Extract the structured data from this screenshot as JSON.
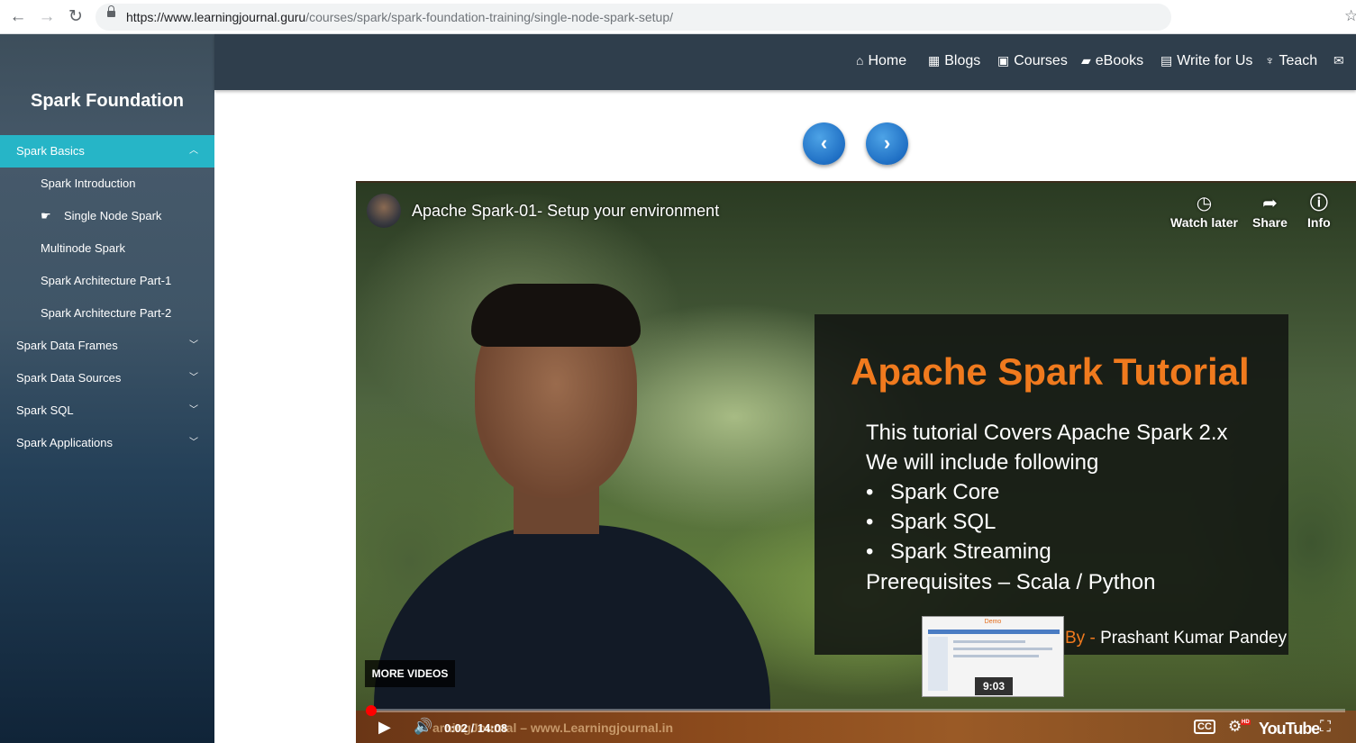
{
  "browser": {
    "url_host": "https://www.learningjournal.guru",
    "url_path": "/courses/spark/spark-foundation-training/single-node-spark-setup/"
  },
  "sidebar": {
    "title": "Spark Foundation",
    "sections": [
      {
        "label": "Spark Basics",
        "expanded": true
      },
      {
        "label": "Spark Data Frames",
        "expanded": false
      },
      {
        "label": "Spark Data Sources",
        "expanded": false
      },
      {
        "label": "Spark SQL",
        "expanded": false
      },
      {
        "label": "Spark Applications",
        "expanded": false
      }
    ],
    "sub_items": [
      {
        "label": "Spark Introduction"
      },
      {
        "label": "Single Node Spark",
        "current": true
      },
      {
        "label": "Multinode Spark"
      },
      {
        "label": "Spark Architecture Part-1"
      },
      {
        "label": "Spark Architecture Part-2"
      }
    ]
  },
  "topnav": {
    "items": [
      {
        "label": "Home",
        "icon": "home-icon"
      },
      {
        "label": "Blogs",
        "icon": "grid-icon"
      },
      {
        "label": "Courses",
        "icon": "play-square-icon"
      },
      {
        "label": "eBooks",
        "icon": "book-icon"
      },
      {
        "label": "Write for Us",
        "icon": "edit-icon"
      },
      {
        "label": "Teach",
        "icon": "teach-icon"
      }
    ]
  },
  "video": {
    "title": "Apache Spark-01- Setup your environment",
    "actions": {
      "watch_later": "Watch later",
      "share": "Share",
      "info": "Info"
    },
    "slide": {
      "title": "Apache Spark Tutorial",
      "line1": "This tutorial Covers Apache Spark 2.x",
      "line2": "We will include following",
      "bullets": [
        "Spark Core",
        "Spark SQL",
        "Spark Streaming"
      ],
      "line3": "Prerequisites – Scala / Python",
      "by_prefix": "By - ",
      "by_name": "Prashant Kumar Pandey"
    },
    "thumbnail": {
      "demo_label": "Demo",
      "duration": "9:03"
    },
    "more_videos": "MORE VIDEOS",
    "watermark": "arningJournal – www.Learningjournal.in",
    "time_current": "0:02",
    "time_total": "14:08",
    "time_display": "0:02 / 14:08",
    "cc_label": "CC",
    "hd_label": "HD",
    "youtube_label": "YouTube",
    "progress_fraction": 0.0024
  },
  "colors": {
    "sidebar_active": "#26b5c7",
    "topnav_bg": "#2f3e4c",
    "slide_title": "#f07a1e",
    "progress": "#ff0000"
  }
}
